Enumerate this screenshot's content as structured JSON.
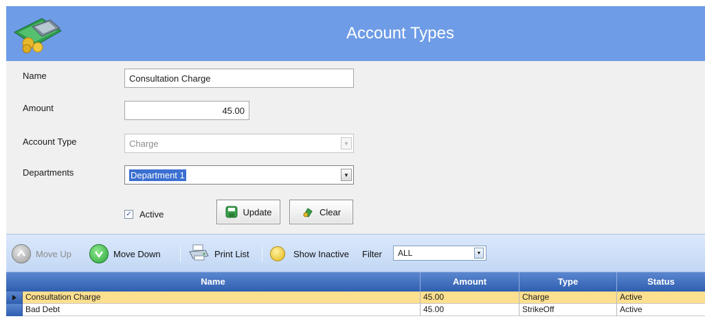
{
  "header": {
    "title": "Account Types"
  },
  "form": {
    "name_label": "Name",
    "name_value": "Consultation Charge",
    "amount_label": "Amount",
    "amount_value": "45.00",
    "account_type_label": "Account Type",
    "account_type_value": "Charge",
    "departments_label": "Departments",
    "departments_value": "Department 1",
    "active_label": "Active",
    "active_checked": true,
    "update_label": "Update",
    "clear_label": "Clear"
  },
  "toolbar": {
    "move_up_label": "Move Up",
    "move_down_label": "Move Down",
    "print_list_label": "Print List",
    "show_inactive_label": "Show Inactive",
    "filter_label": "Filter",
    "filter_value": "ALL"
  },
  "grid": {
    "columns": [
      "Name",
      "Amount",
      "Type",
      "Status"
    ],
    "rows": [
      {
        "name": "Consultation Charge",
        "amount": "45.00",
        "type": "Charge",
        "status": "Active",
        "selected": true
      },
      {
        "name": "Bad Debt",
        "amount": "45.00",
        "type": "StrikeOff",
        "status": "Active",
        "selected": false
      }
    ]
  },
  "colors": {
    "header_bg": "#6e9ce6",
    "grid_header": "#3a68b8",
    "selected_row": "#fcdf8f",
    "move_down_green": "#3cb84a"
  }
}
